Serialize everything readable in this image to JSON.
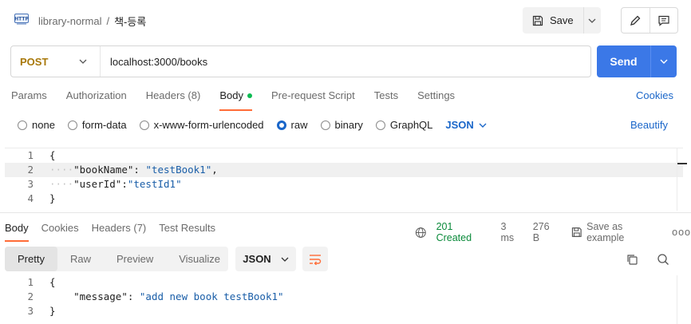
{
  "header": {
    "collection": "library-normal",
    "separator": "/",
    "request_name": "책-등록",
    "save_label": "Save"
  },
  "request": {
    "method": "POST",
    "url": "localhost:3000/books",
    "send_label": "Send"
  },
  "request_tabs": [
    {
      "label": "Params"
    },
    {
      "label": "Authorization"
    },
    {
      "label": "Headers (8)"
    },
    {
      "label": "Body",
      "active": true
    },
    {
      "label": "Pre-request Script"
    },
    {
      "label": "Tests"
    },
    {
      "label": "Settings"
    }
  ],
  "cookies_label": "Cookies",
  "body_types": [
    "none",
    "form-data",
    "x-www-form-urlencoded",
    "raw",
    "binary",
    "GraphQL"
  ],
  "body_type_selected": "raw",
  "body_format": "JSON",
  "beautify_label": "Beautify",
  "request_body": {
    "line_numbers": [
      "1",
      "2",
      "3",
      "4"
    ],
    "l1": "{",
    "l2_key": "\"bookName\"",
    "l2_colon": ": ",
    "l2_val": "\"testBook1\"",
    "l2_end": ",",
    "l3_key": "\"userId\"",
    "l3_colon": ":",
    "l3_val": "\"testId1\"",
    "l4": "}"
  },
  "response_tabs": [
    "Body",
    "Cookies",
    "Headers (7)",
    "Test Results"
  ],
  "response_meta": {
    "status": "201 Created",
    "time": "3 ms",
    "size": "276 B",
    "save_example": "Save as example",
    "more": "ooo"
  },
  "response_views": [
    "Pretty",
    "Raw",
    "Preview",
    "Visualize"
  ],
  "response_format": "JSON",
  "response_body": {
    "line_numbers": [
      "1",
      "2",
      "3"
    ],
    "l1": "{",
    "l2_key": "\"message\"",
    "l2_colon": ": ",
    "l2_val": "\"add new book testBook1\"",
    "l3": "}"
  },
  "colors": {
    "accent": "#ff6c37",
    "send": "#3b78e7",
    "link": "#1a66c9",
    "status_ok": "#0a8a3a",
    "method_post": "#a8780a"
  }
}
